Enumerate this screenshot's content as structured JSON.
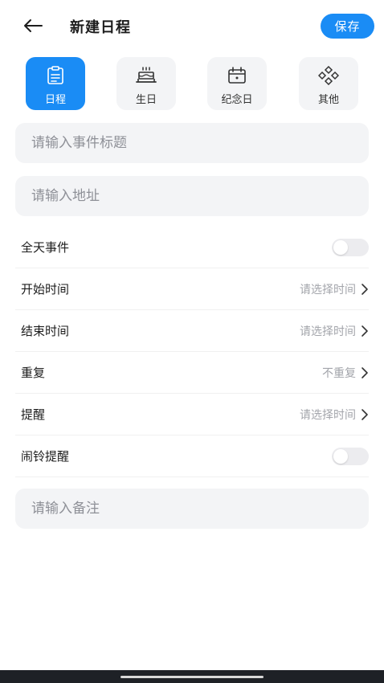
{
  "header": {
    "title": "新建日程",
    "back_icon": "arrow-left-icon",
    "save_label": "保存"
  },
  "colors": {
    "accent": "#1a8cf5",
    "field_bg": "#f3f4f6",
    "placeholder": "#8e9097",
    "secondary_text": "#a3a5ab"
  },
  "types": [
    {
      "label": "日程",
      "icon": "clipboard-list-icon",
      "active": true
    },
    {
      "label": "生日",
      "icon": "birthday-cake-icon",
      "active": false
    },
    {
      "label": "纪念日",
      "icon": "calendar-icon",
      "active": false
    },
    {
      "label": "其他",
      "icon": "diamonds-icon",
      "active": false
    }
  ],
  "fields": {
    "title_placeholder": "请输入事件标题",
    "address_placeholder": "请输入地址",
    "note_placeholder": "请输入备注"
  },
  "rows": {
    "all_day": {
      "label": "全天事件",
      "on": false
    },
    "start_time": {
      "label": "开始时间",
      "value": "请选择时间"
    },
    "end_time": {
      "label": "结束时间",
      "value": "请选择时间"
    },
    "repeat": {
      "label": "重复",
      "value": "不重复"
    },
    "reminder": {
      "label": "提醒",
      "value": "请选择时间"
    },
    "alarm": {
      "label": "闹铃提醒",
      "on": false
    }
  }
}
